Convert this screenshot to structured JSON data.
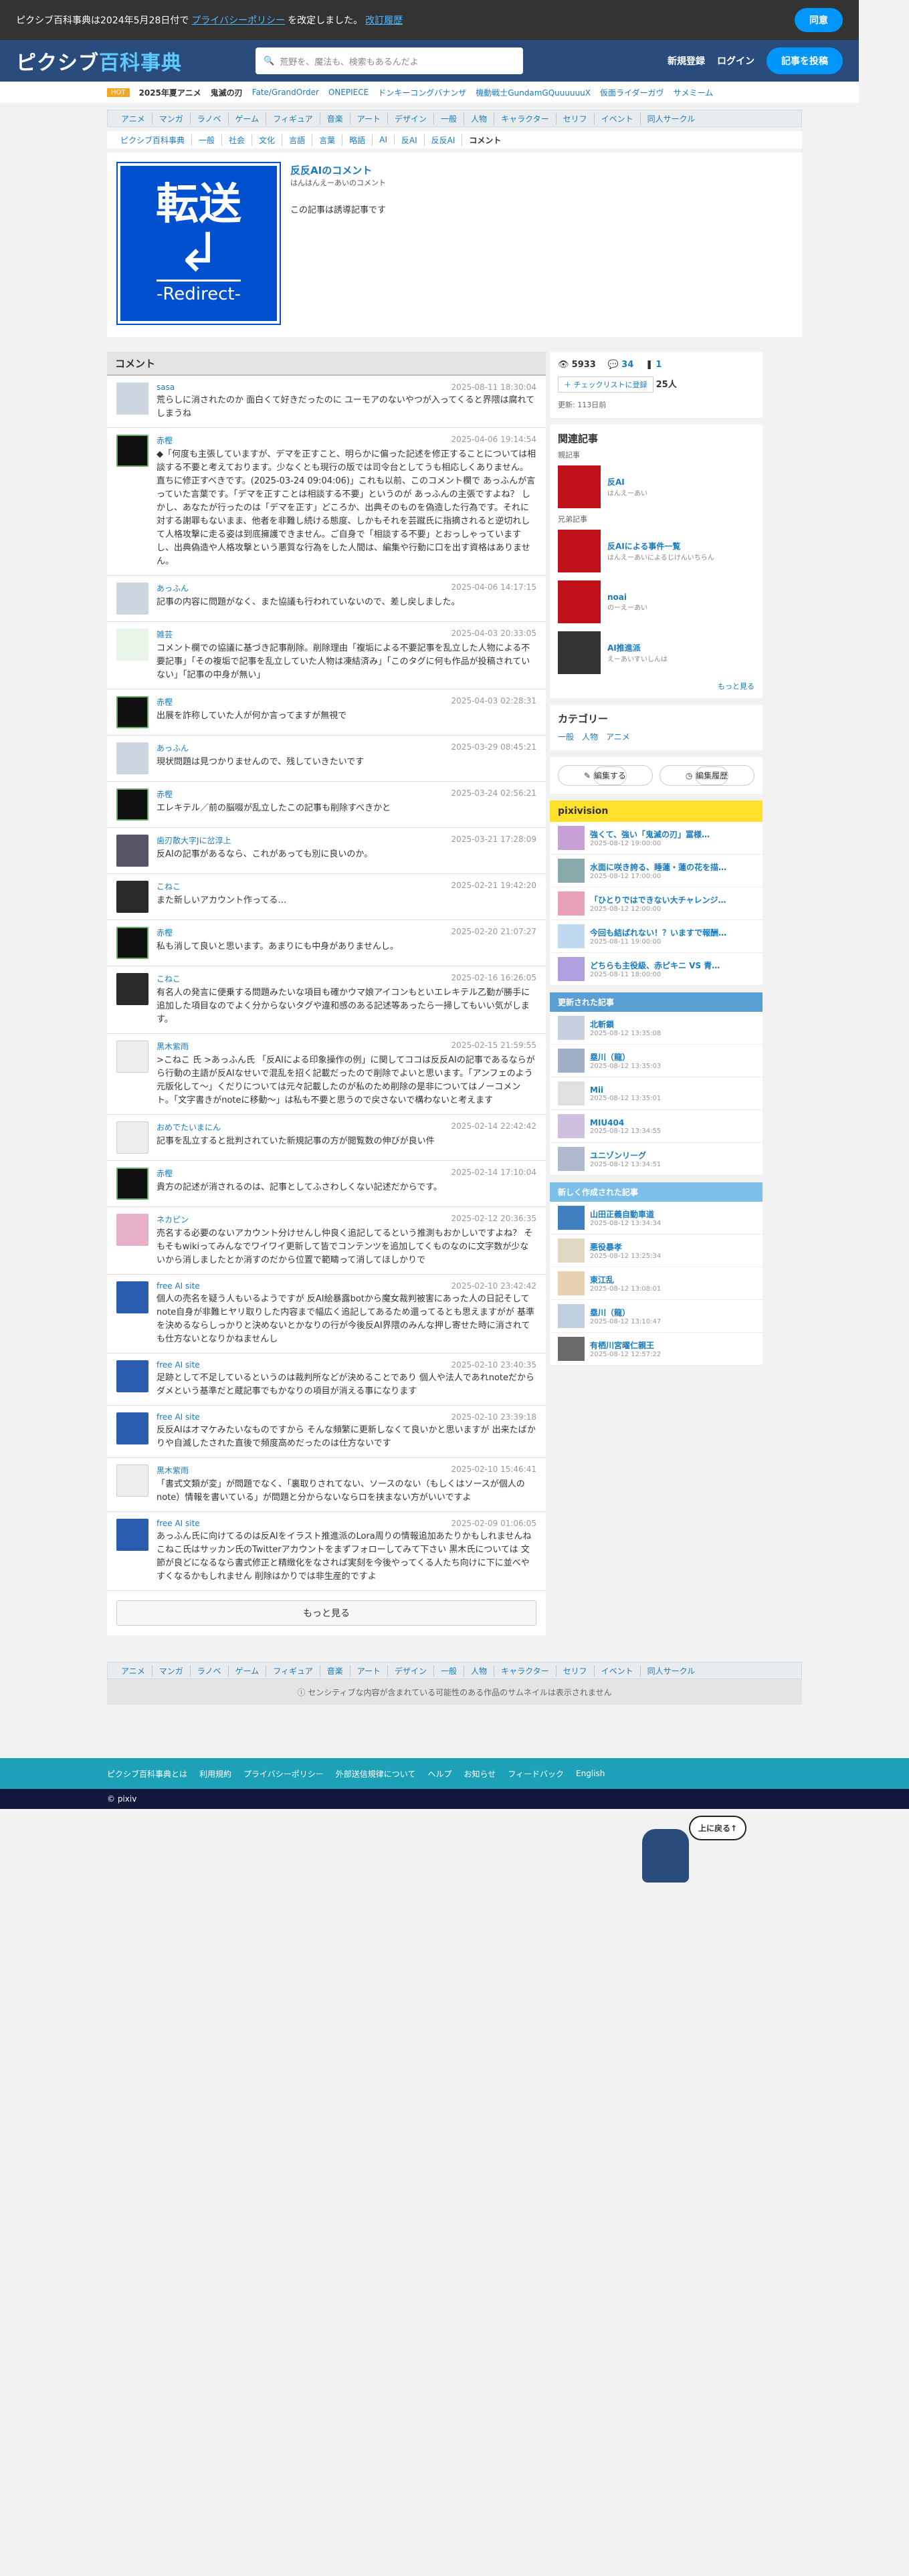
{
  "notice": {
    "text": "ピクシブ百科事典は2024年5月28日付で",
    "link1": "プライバシーポリシー",
    "text2": "を改定しました。",
    "link2": "改訂履歴",
    "agree": "同意"
  },
  "header": {
    "logo_a": "ピクシブ",
    "logo_b": "百科事典",
    "search_placeholder": "荒野を、魔法も、検索もあるんだよ",
    "signup": "新規登録",
    "login": "ログイン",
    "post": "記事を投稿"
  },
  "trend": {
    "tag": "HOT",
    "items": [
      "2025年夏アニメ",
      "鬼滅の刃",
      "Fate/GrandOrder",
      "ONEPIECE",
      "ドンキーコングバナンザ",
      "機動戦士GundamGQuuuuuuX",
      "仮面ライダーガヴ",
      "サメミーム"
    ]
  },
  "categories": [
    "アニメ",
    "マンガ",
    "ラノベ",
    "ゲーム",
    "フィギュア",
    "音楽",
    "アート",
    "デザイン",
    "一般",
    "人物",
    "キャラクター",
    "セリフ",
    "イベント",
    "同人サークル"
  ],
  "breadcrumb": [
    "ピクシブ百科事典",
    "一般",
    "社会",
    "文化",
    "言語",
    "言葉",
    "略語",
    "AI",
    "反AI",
    "反反AI",
    "コメント"
  ],
  "article": {
    "badge_big": "転送",
    "badge_arrow": "↲",
    "badge_small": "-Redirect-",
    "title": "反反AIのコメント",
    "yomi": "はんはんえーあいのコメント",
    "desc": "この記事は誘導記事です"
  },
  "comments_title": "コメント",
  "comments": [
    {
      "name": "sasa",
      "date": "2025-08-11 18:30:04",
      "text": "荒らしに消されたのか 面白くて好きだったのに ユーモアのないやつが入ってくると界隈は腐れてしまうね",
      "av": "gray"
    },
    {
      "name": "赤樫",
      "date": "2025-04-06 19:14:54",
      "text": "◆「何度も主張していますが、デマを正すこと、明らかに偏った記述を修正することについては相談する不要と考えております。少なくとも現行の版では司令台としてうも相応しくありません。直ちに修正すべきです。(2025-03-24 09:04:06)」これも以前、このコメント欄で あっふんが言っていた言葉です。「デマを正すことは相談する不要」というのが あっふんの主張ですよね？ しかし、あなたが行ったのは「デマを正す」どころか、出典そのものを偽造した行為です。それに対する謝罪もないまま、他者を非難し続ける態度、しかもそれを芸蹴氏に指摘されると逆切れして人格攻撃に走る姿は到底擁護できません。ご自身で「相談する不要」とおっしゃっていますし、出典偽造や人格攻撃という悪質な行為をした人間は、編集や行動に口を出す資格はありません。",
      "av": "black"
    },
    {
      "name": "あっふん",
      "date": "2025-04-06 14:17:15",
      "text": "記事の内容に問題がなく、また協議も行われていないので、差し戻しました。",
      "av": "gray"
    },
    {
      "name": "雑芸",
      "date": "2025-04-03 20:33:05",
      "text": "コメント欄での協議に基づき記事削除。削除理由「複垢による不要記事を乱立した人物による不要記事」「その複垢で記事を乱立していた人物は凍結済み」「このタグに何も作品が投稿されていない」「記事の中身が無い」",
      "av": "green"
    },
    {
      "name": "赤樫",
      "date": "2025-04-03 02:28:31",
      "text": "出展を詐称していた人が何か言ってますが無視で",
      "av": "black"
    },
    {
      "name": "あっふん",
      "date": "2025-03-29 08:45:21",
      "text": "現状問題は見つかりませんので、残していきたいです",
      "av": "gray"
    },
    {
      "name": "赤樫",
      "date": "2025-03-24 02:56:21",
      "text": "エレキテル／前の脳啜が乱立したこの記事も削除すべきかと",
      "av": "black"
    },
    {
      "name": "歯刃散大字Jに岔淳上",
      "date": "2025-03-21 17:28:09",
      "text": "反AIの記事があるなら、これがあっても別に良いのか。",
      "av": "photo"
    },
    {
      "name": "こねこ",
      "date": "2025-02-21 19:42:20",
      "text": "また新しいアカウント作ってる…",
      "av": "dark"
    },
    {
      "name": "赤樫",
      "date": "2025-02-20 21:07:27",
      "text": "私も消して良いと思います。あまりにも中身がありませんし。",
      "av": "black"
    },
    {
      "name": "こねこ",
      "date": "2025-02-16 16:26:05",
      "text": "有名人の発言に便乗する問題みたいな項目も確かウマ娘アイコンもといエレキテル乙勤が勝手に追加した項目なのでよく分からないタグや違和感のある記述等あったら一掃してもいい気がします。",
      "av": "dark"
    },
    {
      "name": "黒木紫雨",
      "date": "2025-02-15 21:59:55",
      "text": ">こねこ 氏 >あっふん氏 「反AIによる印象操作の例」に関してココは反反AIの記事であるならがら行動の主語が反AIなせいで混乱を招く記載だったので削除でよいと思います。「アンフェのよう元版化して〜」くだりについては元々記載したのが私のため削除の是非についてはノーコメント。「文字書きがnoteに移動〜」は私も不要と思うので戻さないで構わないと考えます",
      "av": "white"
    },
    {
      "name": "おめでたいまにん",
      "date": "2025-02-14 22:42:42",
      "text": "記事を乱立すると批判されていた新規記事の方が閲覧数の伸びが良い件",
      "av": "white"
    },
    {
      "name": "赤樫",
      "date": "2025-02-14 17:10:04",
      "text": "貴方の記述が消されるのは、記事としてふさわしくない記述だからです。",
      "av": "black"
    },
    {
      "name": "ネカピン",
      "date": "2025-02-12 20:36:35",
      "text": "売名する必要のないアカウント分けせんし仲良く追記してるという推測もおかしいですよね？ そもそもwikiってみんなでワイワイ更新して皆でコンテンツを追加してくものなのに文字数が少ないから消しましたとか消すのだから位置で範疇って消してほしかりで",
      "av": "pink"
    },
    {
      "name": "free AI site",
      "date": "2025-02-10 23:42:42",
      "text": "個人の売名を疑う人もいるようですが 反AI絵暴露botから魔女裁判被害にあった人の日記そしてnote自身が非難ヒヤリ取りした内容まで幅広く追記してあるため還ってるとも思えますがが 基準を決めるならしっかりと決めないとかなりの行が今後反AI界隈のみんな押し寄せた時に消されても仕方ないとなりかねませんし",
      "av": "blue"
    },
    {
      "name": "free AI site",
      "date": "2025-02-10 23:40:35",
      "text": "足跡として不足しているというのは裁判所などが決めることであり 個人や法人であれnoteだからダメという基準だと蔵記事でもかなりの項目が消える事になります",
      "av": "blue"
    },
    {
      "name": "free AI site",
      "date": "2025-02-10 23:39:18",
      "text": "反反AIはオマケみたいなものですから そんな頻繁に更新しなくて良いかと思いますが 出来たばかりや自滅したされた直後で頻度高めだったのは仕方ないです",
      "av": "blue"
    },
    {
      "name": "黒木紫雨",
      "date": "2025-02-10 15:46:41",
      "text": "「書式文類が変」が問題でなく、「裏取りされてない、ソースのない（もしくはソースが個人のnote）情報を書いている」が問題と分からないならロを挟まない方がいいですよ",
      "av": "white"
    },
    {
      "name": "free AI site",
      "date": "2025-02-09 01:06:05",
      "text": "あっふん氏に向けてるのは反AIをイラスト推進派のLora周りの情報追加あたりかもしれませんね こねこ氏はサッカン氏のTwitterアカウントをまずフォローしてみて下さい 黒木氏については 文節が良どになるなら書式修正と精緻化をなされば実刻を今後やってくる人たち向けに下に並べやすくなるかもしれません 削除はかりでは非生産的ですよ",
      "av": "blue"
    }
  ],
  "more": "もっと見る",
  "stats": {
    "views": "5933",
    "comments": "34",
    "pics": "1",
    "checklist": "チェックリストに登録",
    "count": "25人",
    "updated": "更新: 113日前"
  },
  "related": {
    "title": "関連記事",
    "sub1": "親記事",
    "sub2": "兄弟記事",
    "items": [
      {
        "t": "反AI",
        "y": "はんえーあい"
      },
      {
        "t": "反AIによる事件一覧",
        "y": "はんえーあいによるじけんいちらん"
      },
      {
        "t": "noai",
        "y": "のーえーあい"
      },
      {
        "t": "AI推進派",
        "y": "えーあいすいしんは"
      }
    ],
    "more": "もっと見る"
  },
  "category": {
    "title": "カテゴリー",
    "links": "一般　人物　アニメ"
  },
  "edit": {
    "edit": "編集する",
    "history": "編集履歴"
  },
  "pixivision": {
    "title": "pixivision",
    "items": [
      {
        "t": "強くて、強い「鬼滅の刃」冨様…",
        "d": "2025-08-12 19:00:00"
      },
      {
        "t": "水面に咲き誇る、睡蓮・蓮の花を描…",
        "d": "2025-08-12 17:00:00"
      },
      {
        "t": "「ひとりではできない大チャレンジ…",
        "d": "2025-08-12 12:00:00"
      },
      {
        "t": "今回も結ばれない！？いますで報酬…",
        "d": "2025-08-11 19:00:00"
      },
      {
        "t": "どちらも主役級、赤ピキニ VS 青…",
        "d": "2025-08-11 18:00:00"
      }
    ]
  },
  "updated": {
    "title": "更新された記事",
    "items": [
      {
        "t": "北斬鎖",
        "d": "2025-08-12 13:35:08"
      },
      {
        "t": "塁川（龍）",
        "d": "2025-08-12 13:35:03"
      },
      {
        "t": "Mii",
        "d": "2025-08-12 13:35:01"
      },
      {
        "t": "MIU404",
        "d": "2025-08-12 13:34:55"
      },
      {
        "t": "ユニゾンリーグ",
        "d": "2025-08-12 13:34:51"
      }
    ]
  },
  "newart": {
    "title": "新しく作成された記事",
    "items": [
      {
        "t": "山田正義自動車道",
        "d": "2025-08-12 13:34:34"
      },
      {
        "t": "悪役暴孝",
        "d": "2025-08-12 13:25:34"
      },
      {
        "t": "東江乱",
        "d": "2025-08-12 13:08:01"
      },
      {
        "t": "塁川（龍）",
        "d": "2025-08-12 13:10:47"
      },
      {
        "t": "有栖川宮曜仁親王",
        "d": "2025-08-12 12:57:22"
      }
    ]
  },
  "sensitive": "センシティブな内容が含まれている可能性のある作品のサムネイルは表示されません",
  "footer": {
    "links": [
      "ピクシブ百科事典とは",
      "利用規約",
      "プライバシーポリシー",
      "外部送信規律について",
      "ヘルプ",
      "お知らせ",
      "フィードバック",
      "English"
    ],
    "copy": "© pixiv",
    "totop": "上に戻る↑"
  }
}
